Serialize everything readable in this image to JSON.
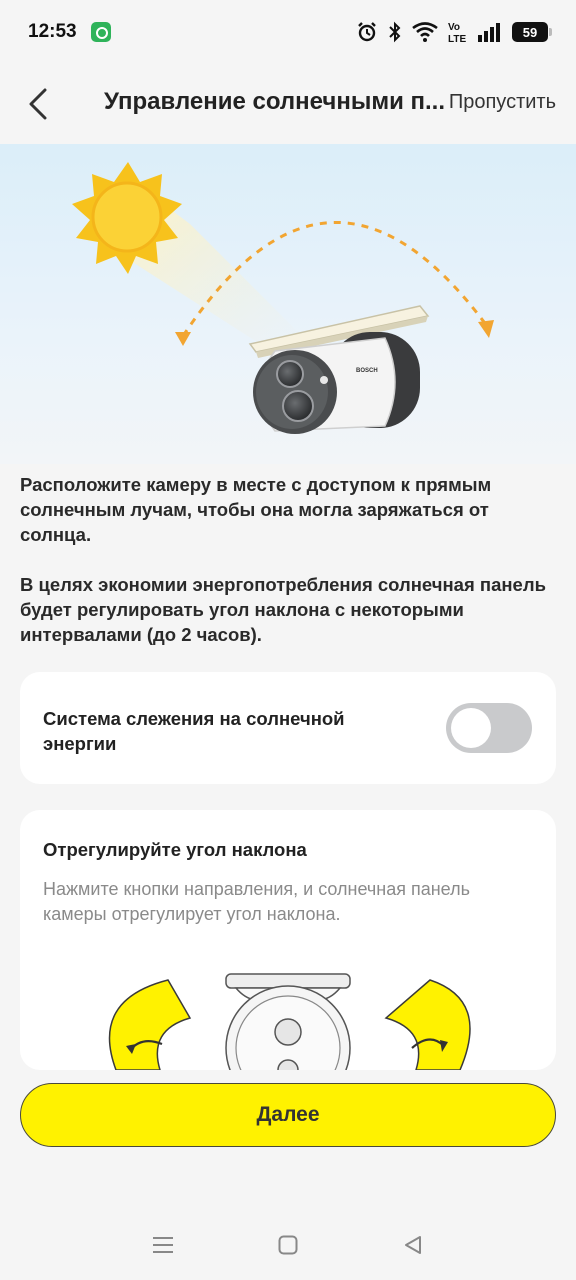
{
  "status_bar": {
    "time": "12:53",
    "battery_level": "59",
    "icons": [
      "notification-app-icon",
      "alarm-icon",
      "bluetooth-icon",
      "wifi-icon",
      "volte-icon",
      "signal-icon",
      "battery-icon"
    ]
  },
  "header": {
    "title": "Управление солнечными п...",
    "skip_label": "Пропустить",
    "back_icon": "back-arrow-icon"
  },
  "hero": {
    "camera_brand": "BOSCH"
  },
  "description": {
    "paragraph1": "Расположите камеру в месте с доступом к прямым солнечным лучам, чтобы она могла заряжаться от солнца.",
    "paragraph2": "В целях экономии энергопотребления солнечная панель будет регулировать угол наклона с некоторыми интервалами (до 2 часов)."
  },
  "solar_tracking": {
    "label": "Система слежения на солнечной энергии",
    "enabled": false
  },
  "angle_adjust": {
    "title": "Отрегулируйте угол наклона",
    "description": "Нажмите кнопки направления, и солнечная панель камеры отрегулирует угол наклона."
  },
  "next_button": {
    "label": "Далее"
  },
  "nav_bar": {
    "icons": [
      "menu-icon",
      "home-icon",
      "back-icon"
    ]
  },
  "colors": {
    "accent_yellow": "#fff200",
    "sun_yellow": "#f7c21c",
    "arrow_orange": "#f2a531",
    "toggle_off": "#c9cacc",
    "background": "#f5f5f5"
  }
}
